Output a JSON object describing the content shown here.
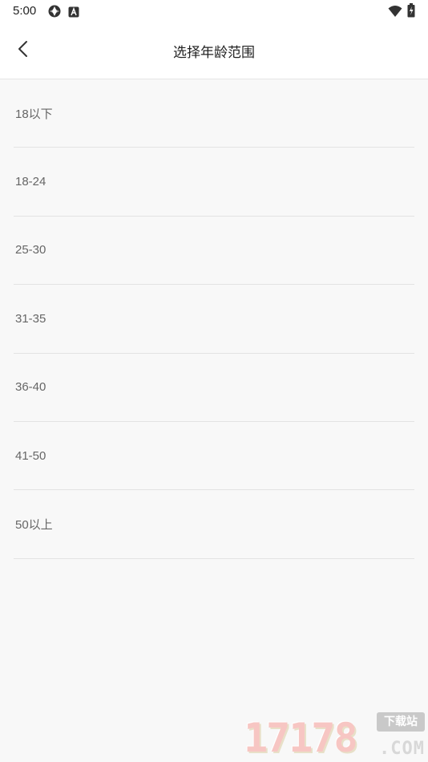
{
  "status_bar": {
    "time": "5:00",
    "left_icons": [
      "photo-icon",
      "a-badge-icon"
    ],
    "right_icons": [
      "wifi-icon",
      "battery-icon"
    ]
  },
  "header": {
    "back_icon": "chevron-left-icon",
    "title": "选择年龄范围"
  },
  "age_ranges": [
    {
      "label": "18以下"
    },
    {
      "label": "18-24"
    },
    {
      "label": "25-30"
    },
    {
      "label": "31-35"
    },
    {
      "label": "36-40"
    },
    {
      "label": "41-50"
    },
    {
      "label": "50以上"
    }
  ],
  "watermark": {
    "digits": "17178",
    "badge": "下载站",
    "suffix": ".COM"
  },
  "colors": {
    "background": "#f8f8f8",
    "header_bg": "#ffffff",
    "divider": "#e3e3e3",
    "item_text": "#666666",
    "title_text": "#222222"
  }
}
